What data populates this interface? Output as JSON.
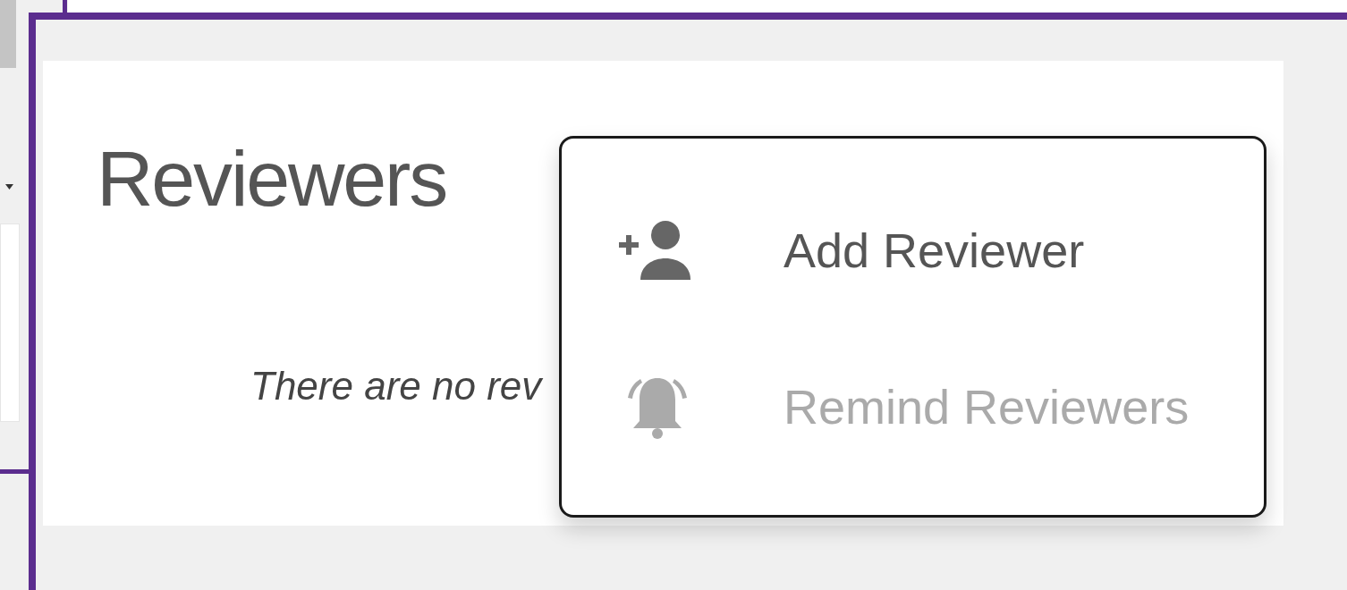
{
  "card": {
    "title": "Reviewers",
    "empty_message": "There are no rev"
  },
  "menu": {
    "items": [
      {
        "label": "Add Reviewer",
        "kind": "add-person",
        "disabled": false
      },
      {
        "label": "Remind Reviewers",
        "kind": "bell",
        "disabled": true
      }
    ]
  }
}
